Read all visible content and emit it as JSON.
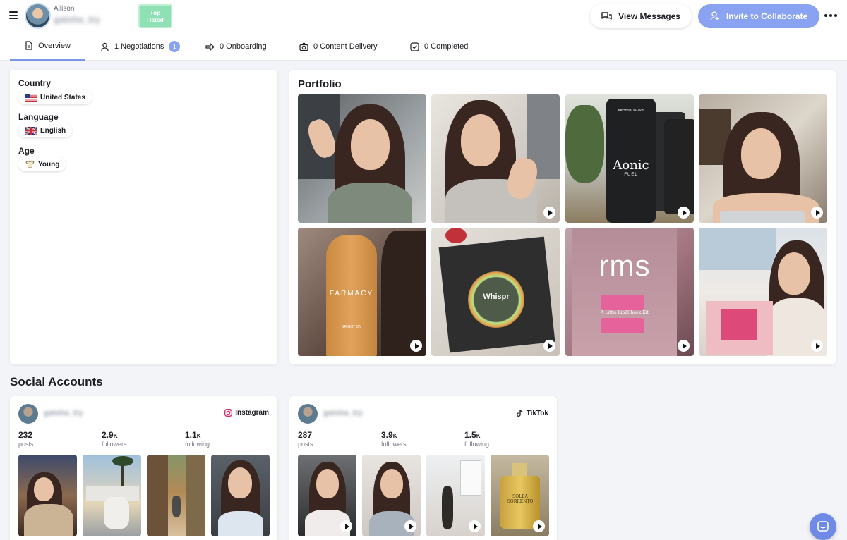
{
  "header": {
    "menu_icon": "hamburger-icon",
    "creator_first_name": "Allison",
    "creator_handle": "gatsha_try",
    "badge_label_line1": "Top",
    "badge_label_line2": "Rated",
    "view_messages_label": "View Messages",
    "invite_label": "Invite to Collaborate",
    "more_icon": "more-dots-icon"
  },
  "tabs": [
    {
      "label": "Overview",
      "icon": "document-icon",
      "active": true
    },
    {
      "label": "1 Negotiations",
      "icon": "user-icon",
      "badge": "1"
    },
    {
      "label": "0 Onboarding",
      "icon": "arrow-right-icon"
    },
    {
      "label": "0 Content Delivery",
      "icon": "camera-icon"
    },
    {
      "label": "0 Completed",
      "icon": "check-icon"
    }
  ],
  "profile": {
    "country_label": "Country",
    "country_value": "United States",
    "language_label": "Language",
    "language_value": "English",
    "age_label": "Age",
    "age_value": "Young"
  },
  "portfolio": {
    "title": "Portfolio",
    "tiles": [
      {
        "scene": "waving-woman",
        "video": false
      },
      {
        "scene": "peace-sign-woman",
        "video": true
      },
      {
        "scene": "aonic-can",
        "video": true,
        "text": "Aonic",
        "subtext": "FUEL"
      },
      {
        "scene": "woman-kitchen",
        "video": true
      },
      {
        "scene": "farmacy-bottle",
        "video": true,
        "text": "FARMACY"
      },
      {
        "scene": "whisper-box",
        "video": true,
        "text": "Whispr"
      },
      {
        "scene": "rms-box",
        "video": true,
        "text": "rms"
      },
      {
        "scene": "woman-pink-box",
        "video": true
      }
    ]
  },
  "social_section_title": "Social Accounts",
  "social_accounts": [
    {
      "handle": "gatsha_try",
      "platform": "Instagram",
      "platform_icon": "instagram-icon",
      "posts": "232",
      "posts_label": "posts",
      "followers": "2.9",
      "followers_unit": "K",
      "followers_label": "followers",
      "following": "1.1",
      "following_unit": "K",
      "following_label": "following"
    },
    {
      "handle": "gatsha_try",
      "platform": "TikTok",
      "platform_icon": "tiktok-icon",
      "posts": "287",
      "posts_label": "posts",
      "followers": "3.9",
      "followers_unit": "K",
      "followers_label": "followers",
      "following": "1.5",
      "following_unit": "K",
      "following_label": "following"
    }
  ],
  "product_text": {
    "aonic_sub": "PROTEIN SHAKE",
    "farmacy_sub": "BRIGHT ON",
    "rms_sub": "A Little Lip2Cheek Kit",
    "solea": "SOLEA SORRENTO"
  },
  "colors": {
    "accent": "#8aa2f2",
    "badge": "#8fe0b4"
  }
}
